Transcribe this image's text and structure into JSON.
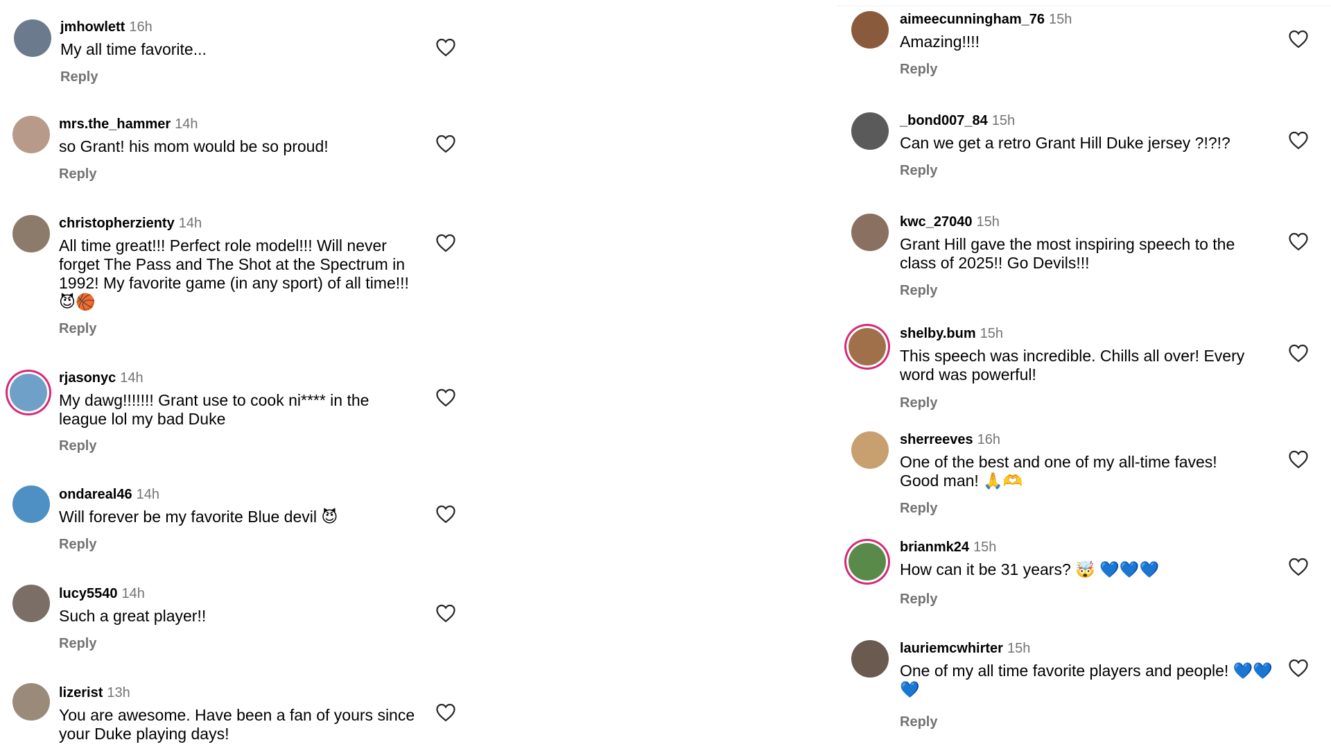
{
  "left_comments": [
    {
      "username": "jmhowlett",
      "time": "16h",
      "text": "My all time favorite...",
      "reply": "Reply",
      "avatar_color": "#6b7a8c",
      "ring": false
    },
    {
      "username": "mrs.the_hammer",
      "time": "14h",
      "text": "so Grant! his mom would be so proud!",
      "reply": "Reply",
      "avatar_color": "#b89a8a",
      "ring": false
    },
    {
      "username": "christopherzienty",
      "time": "14h",
      "text": "All time great!!! Perfect role model!!! Will never forget The Pass and The Shot at the Spectrum in 1992! My favorite game (in any sport) of all time!!! 😈🏀",
      "reply": "Reply",
      "avatar_color": "#8c7b6a",
      "ring": false
    },
    {
      "username": "rjasonyc",
      "time": "14h",
      "text": "My dawg!!!!!!! Grant use to cook ni**** in the league lol my bad Duke",
      "reply": "Reply",
      "avatar_color": "#6fa0c8",
      "ring": true
    },
    {
      "username": "ondareal46",
      "time": "14h",
      "text": "Will forever be my favorite Blue devil 😈",
      "reply": "Reply",
      "avatar_color": "#4e8fc4",
      "ring": false
    },
    {
      "username": "lucy5540",
      "time": "14h",
      "text": "Such a great player!!",
      "reply": "Reply",
      "avatar_color": "#7a6e66",
      "ring": false
    },
    {
      "username": "lizerist",
      "time": "13h",
      "text": "You are awesome. Have been a fan of yours since your Duke playing days!",
      "reply": "",
      "avatar_color": "#9a8a7a",
      "ring": false
    }
  ],
  "right_comments": [
    {
      "username": "aimeecunningham_76",
      "time": "15h",
      "text": "Amazing!!!!",
      "reply": "Reply",
      "avatar_color": "#8a5a3c",
      "ring": false
    },
    {
      "username": "_bond007_84",
      "time": "15h",
      "text": "Can we get a retro Grant Hill Duke jersey ?!?!?",
      "reply": "Reply",
      "avatar_color": "#5a5a5a",
      "ring": false
    },
    {
      "username": "kwc_27040",
      "time": "15h",
      "text": "Grant Hill gave the most inspiring speech to the class of 2025!! Go Devils!!!",
      "reply": "Reply",
      "avatar_color": "#8a7060",
      "ring": false
    },
    {
      "username": "shelby.bum",
      "time": "15h",
      "text": "This speech was incredible. Chills all over! Every word was powerful!",
      "reply": "Reply",
      "avatar_color": "#a0704a",
      "ring": true
    },
    {
      "username": "sherreeves",
      "time": "16h",
      "text": "One of the best and one of my all-time faves! Good man! 🙏🫶",
      "reply": "Reply",
      "avatar_color": "#c8a070",
      "ring": false
    },
    {
      "username": "brianmk24",
      "time": "15h",
      "text": "How can it be 31 years? 🤯 💙💙💙",
      "reply": "Reply",
      "avatar_color": "#5a8a4a",
      "ring": true
    },
    {
      "username": "lauriemcwhirter",
      "time": "15h",
      "text": "One of my all time favorite players and people! 💙💙💙",
      "reply": "Reply",
      "avatar_color": "#6a5a50",
      "ring": false
    }
  ],
  "icons": {
    "avatar": "avatar",
    "like": "heart-outline-icon"
  },
  "colors": {
    "muted": "#737373",
    "ring": "#d62976",
    "heart_stroke": "#262626"
  }
}
